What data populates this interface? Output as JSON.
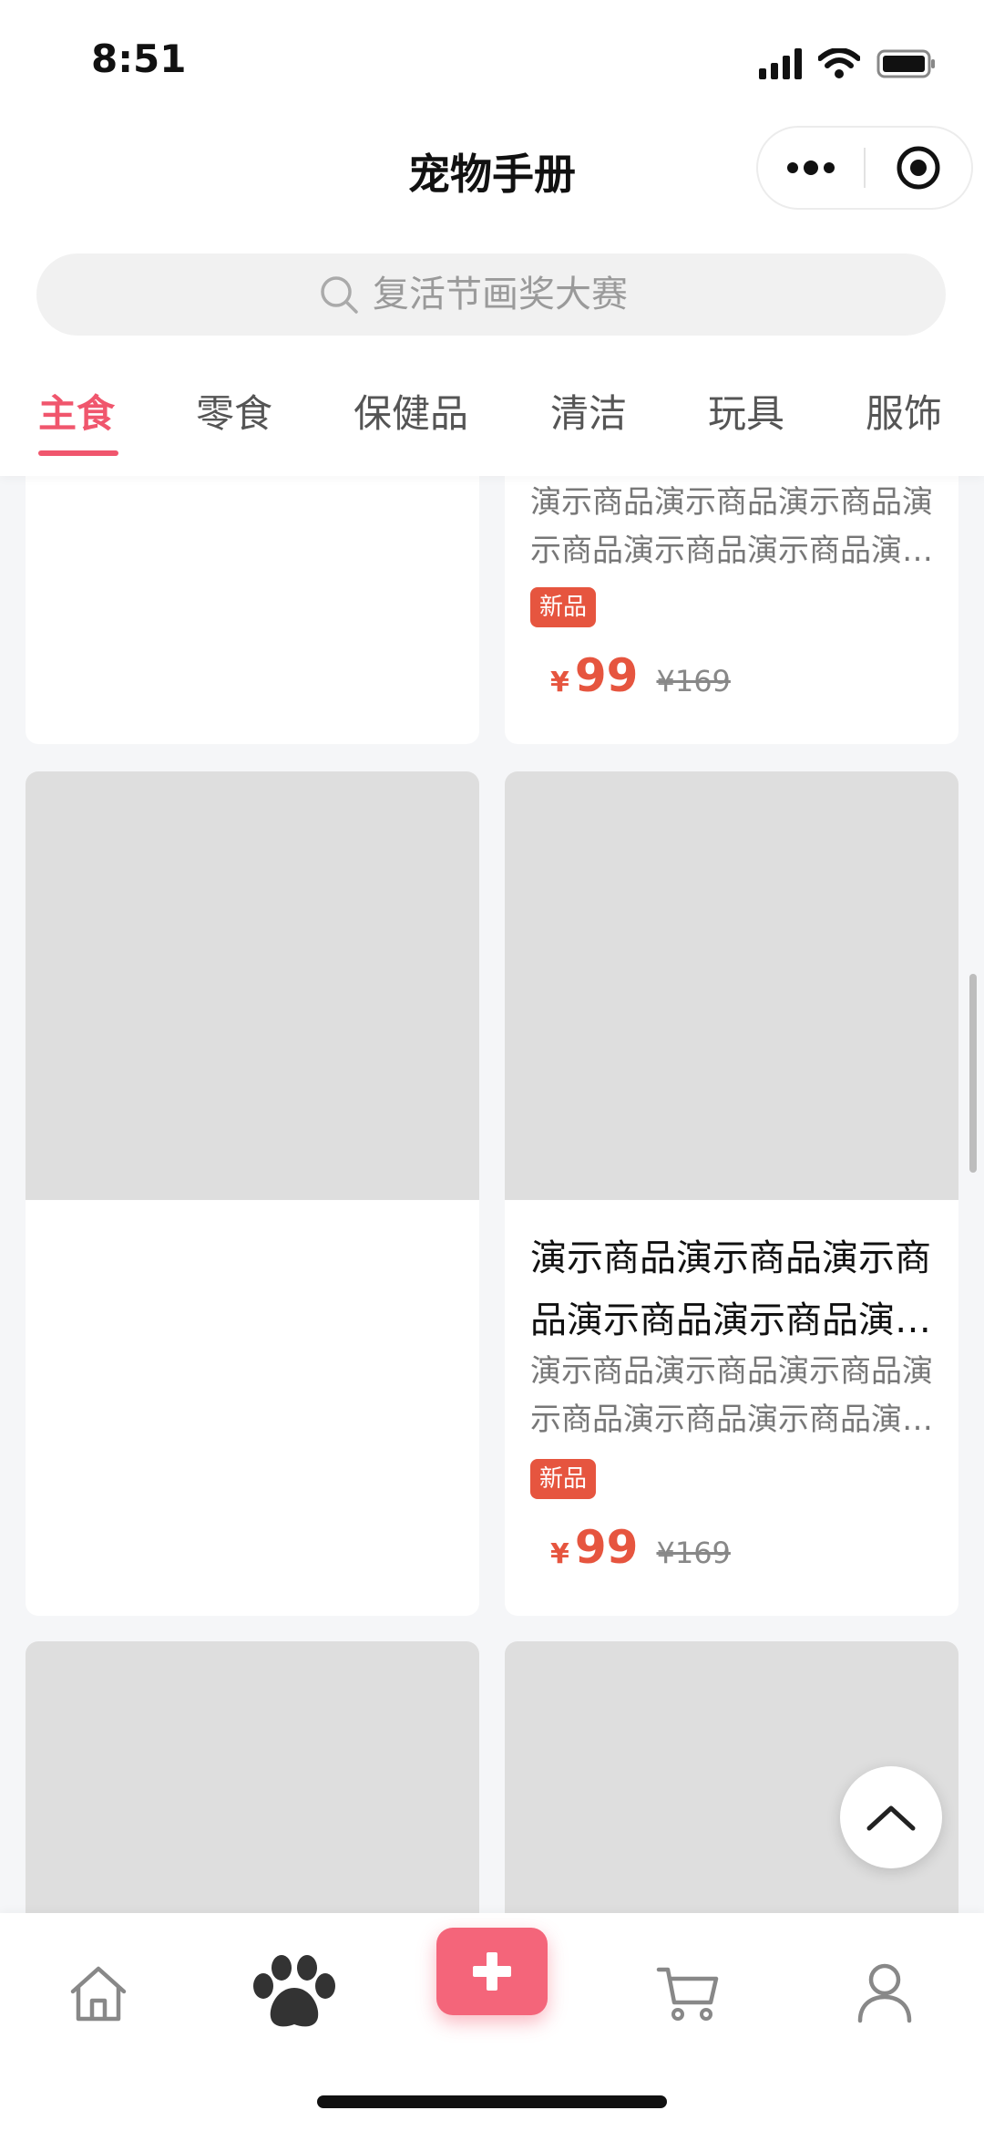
{
  "status_bar": {
    "time": "8:51"
  },
  "header": {
    "title": "宠物手册"
  },
  "search": {
    "placeholder": "复活节画奖大赛"
  },
  "tabs": [
    {
      "label": "主食",
      "active": true
    },
    {
      "label": "零食",
      "active": false
    },
    {
      "label": "保健品",
      "active": false
    },
    {
      "label": "清洁",
      "active": false
    },
    {
      "label": "玩具",
      "active": false
    },
    {
      "label": "服饰",
      "active": false
    }
  ],
  "products": [
    {
      "desc": "演示商品演示商品演示商品演示商品演示商品演示商品演示商品",
      "badge": "新品",
      "currency": "¥",
      "price": "99",
      "original_price": "¥169"
    },
    {
      "title": "演示商品演示商品演示商品演示商品演示商品演示商品",
      "desc": "演示商品演示商品演示商品演示商品演示商品演示商品演示商品",
      "badge": "新品",
      "currency": "¥",
      "price": "99",
      "original_price": "¥169"
    }
  ],
  "colors": {
    "accent": "#f0566d",
    "price": "#e6553f",
    "add_button": "#f4657a"
  },
  "bottom_nav": [
    {
      "icon": "home-icon"
    },
    {
      "icon": "paw-icon",
      "active": true
    },
    {
      "icon": "plus-icon"
    },
    {
      "icon": "cart-icon"
    },
    {
      "icon": "user-icon"
    }
  ]
}
